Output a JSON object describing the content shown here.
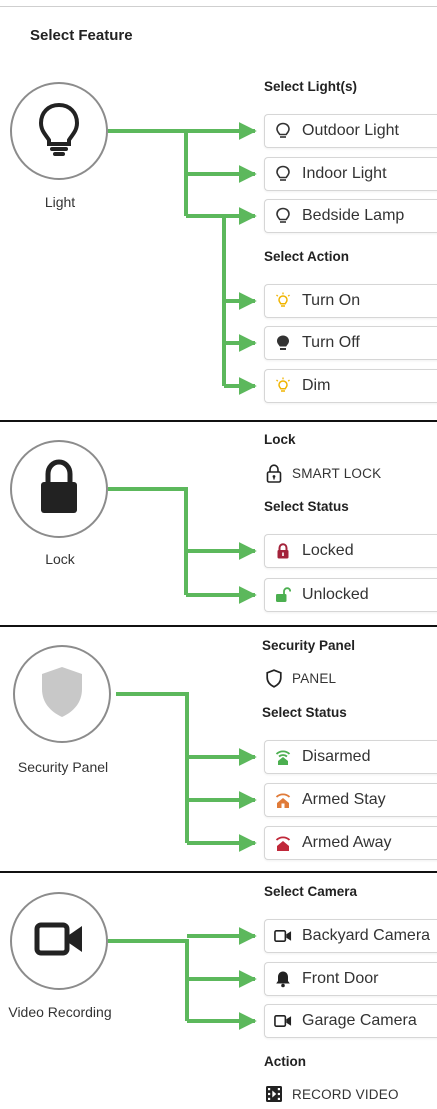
{
  "title": "Select Feature",
  "colors": {
    "connector": "#5cb85c",
    "divider": "#111111"
  },
  "sections": {
    "light": {
      "feature_label": "Light",
      "feature_icon": "lightbulb-icon",
      "select_lights_heading": "Select Light(s)",
      "lights": [
        {
          "label": "Outdoor Light",
          "icon": "lightbulb-outline-icon"
        },
        {
          "label": "Indoor Light",
          "icon": "lightbulb-outline-icon"
        },
        {
          "label": "Bedside Lamp",
          "icon": "lightbulb-outline-icon"
        }
      ],
      "select_action_heading": "Select Action",
      "actions": [
        {
          "label": "Turn On",
          "icon": "lightbulb-on-icon",
          "color": "#f0b400"
        },
        {
          "label": "Turn Off",
          "icon": "lightbulb-off-icon",
          "color": "#333333"
        },
        {
          "label": "Dim",
          "icon": "lightbulb-dim-icon",
          "color": "#f0b400"
        }
      ]
    },
    "lock": {
      "feature_label": "Lock",
      "feature_icon": "padlock-icon",
      "heading": "Lock",
      "device_label": "SMART LOCK",
      "device_icon": "smart-lock-icon",
      "status_heading": "Select Status",
      "statuses": [
        {
          "label": "Locked",
          "icon": "locked-icon",
          "color": "#a3223a"
        },
        {
          "label": "Unlocked",
          "icon": "unlocked-icon",
          "color": "#4caf50"
        }
      ]
    },
    "security": {
      "feature_label": "Security Panel",
      "feature_icon": "shield-icon",
      "heading": "Security Panel",
      "device_label": "PANEL",
      "device_icon": "shield-outline-icon",
      "status_heading": "Select Status",
      "statuses": [
        {
          "label": "Disarmed",
          "icon": "disarmed-icon",
          "color": "#4caf50"
        },
        {
          "label": "Armed Stay",
          "icon": "armed-stay-icon",
          "color": "#e07b39"
        },
        {
          "label": "Armed Away",
          "icon": "armed-away-icon",
          "color": "#c0283a"
        }
      ]
    },
    "video": {
      "feature_label": "Video Recording",
      "feature_icon": "video-camera-icon",
      "camera_heading": "Select Camera",
      "cameras": [
        {
          "label": "Backyard Camera",
          "icon": "camera-outline-icon"
        },
        {
          "label": "Front Door",
          "icon": "doorbell-icon"
        },
        {
          "label": "Garage Camera",
          "icon": "camera-outline-icon"
        }
      ],
      "action_heading": "Action",
      "action_label": "RECORD VIDEO",
      "action_icon": "film-icon"
    }
  }
}
